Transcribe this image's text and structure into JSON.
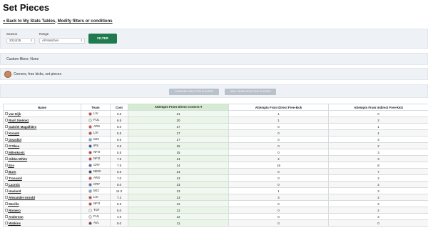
{
  "page": {
    "title": "Set Pieces",
    "back_link": "« Back to My Stats Tables",
    "sep": ", ",
    "modify_link": "Modify filters or conditions"
  },
  "filters": {
    "season_label": "Season",
    "season_value": "2024/25",
    "range_label": "Range",
    "range_value": "All Matches",
    "filter_button": "FILTER"
  },
  "custom_filters": "Custom filters: None",
  "tag": "Corners, free kicks, set pieces",
  "actions": {
    "compare": "COMPARE SELECTED PLAYERS",
    "only_show": "ONLY SHOW SELECTED PLAYERS"
  },
  "table": {
    "headers": [
      "Name",
      "Team",
      "Cost",
      "Attempts From Direct Corners",
      "Attempts From Direct Free-kick",
      "Attempts From Indirect Free-kick"
    ],
    "sort_icon": "▾",
    "rows": [
      {
        "name": "van Dijk",
        "team": "LIV",
        "color": "#d0312d",
        "cost": "6.6",
        "c1": "21",
        "c2": "1",
        "c3": "0"
      },
      {
        "name": "Raúl Jiménez",
        "team": "FUL",
        "color": "#e6e6e6",
        "cost": "6.5",
        "c1": "20",
        "c2": "1",
        "c3": "2"
      },
      {
        "name": "Gabriel Magalhães",
        "team": "ARS",
        "color": "#e53935",
        "cost": "6.0",
        "c1": "17",
        "c2": "0",
        "c3": "1"
      },
      {
        "name": "Konaté",
        "team": "LIV",
        "color": "#d0312d",
        "cost": "5.5",
        "c1": "17",
        "c2": "0",
        "c3": "1"
      },
      {
        "name": "Gvardiol",
        "team": "MCI",
        "color": "#6cabdd",
        "cost": "6.6",
        "c1": "17",
        "c2": "0",
        "c3": "3"
      },
      {
        "name": "O'Shea",
        "team": "IPS",
        "color": "#1c4aa6",
        "cost": "3.6",
        "c1": "15",
        "c2": "0",
        "c3": "2"
      },
      {
        "name": "Milenković",
        "team": "NFO",
        "color": "#dd2b2b",
        "cost": "5.5",
        "c1": "15",
        "c2": "0",
        "c3": "3"
      },
      {
        "name": "Gibbs-White",
        "team": "NFO",
        "color": "#dd2b2b",
        "cost": "7.5",
        "c1": "14",
        "c2": "4",
        "c3": "3"
      },
      {
        "name": "Eze",
        "team": "CRY",
        "color": "#4a5fc1",
        "cost": "7.5",
        "c1": "14",
        "c2": "16",
        "c3": "8"
      },
      {
        "name": "Burn",
        "team": "NEW",
        "color": "#333333",
        "cost": "5.6",
        "c1": "14",
        "c2": "0",
        "c3": "7"
      },
      {
        "name": "Trossard",
        "team": "ARS",
        "color": "#e53935",
        "cost": "7.0",
        "c1": "13",
        "c2": "0",
        "c3": "2"
      },
      {
        "name": "Lacroix",
        "team": "CRY",
        "color": "#4a5fc1",
        "cost": "5.0",
        "c1": "13",
        "c2": "0",
        "c3": "2"
      },
      {
        "name": "Haaland",
        "team": "MCI",
        "color": "#6cabdd",
        "cost": "14.0",
        "c1": "13",
        "c2": "1",
        "c3": "3"
      },
      {
        "name": "Alexander-Arnold",
        "team": "LIV",
        "color": "#d0312d",
        "cost": "7.2",
        "c1": "13",
        "c2": "3",
        "c3": "2"
      },
      {
        "name": "Murillo",
        "team": "NFO",
        "color": "#dd2b2b",
        "cost": "5.5",
        "c1": "12",
        "c2": "0",
        "c3": "3"
      },
      {
        "name": "Romero",
        "team": "TOT",
        "color": "#f2f2f2",
        "cost": "5.0",
        "c1": "12",
        "c2": "0",
        "c3": "2"
      },
      {
        "name": "Anderson",
        "team": "FUL",
        "color": "#e6e6e6",
        "cost": "4.5",
        "c1": "12",
        "c2": "0",
        "c3": "2"
      },
      {
        "name": "Watkins",
        "team": "AVL",
        "color": "#7a1f3d",
        "cost": "9.0",
        "c1": "11",
        "c2": "0",
        "c3": "0"
      }
    ]
  },
  "colors": {
    "accent": "#1f7a4d",
    "sorted_header": "#d4ecd0"
  }
}
